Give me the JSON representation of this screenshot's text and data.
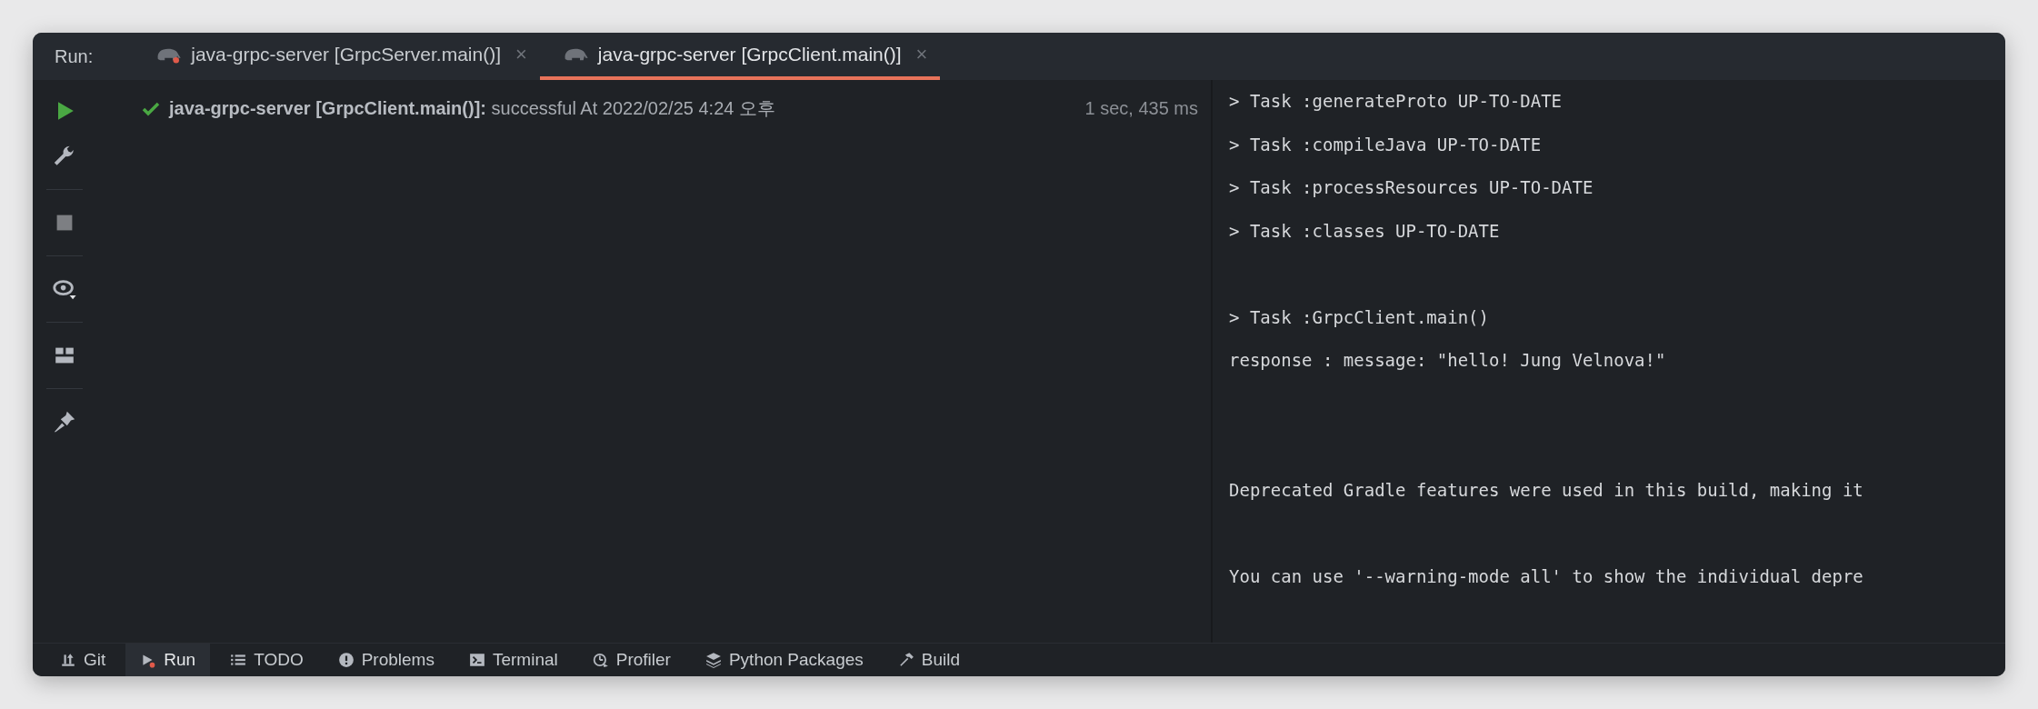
{
  "tool_window": {
    "label": "Run:"
  },
  "tabs": [
    {
      "title": "java-grpc-server [GrpcServer.main()]",
      "selected": false,
      "close": "×"
    },
    {
      "title": "java-grpc-server [GrpcClient.main()]",
      "selected": true,
      "close": "×"
    }
  ],
  "build_tree": {
    "rows": [
      {
        "kind": "success",
        "text": "**java-grpc-server [GrpcClient.main()]:** successful At 2022/02/25 4:24 오후",
        "duration": "1 sec, 435 ms"
      }
    ]
  },
  "console": {
    "lines": [
      {
        "kind": "text",
        "text": "> Task :generateProto UP-TO-DATE"
      },
      {
        "kind": "text",
        "text": "> Task :compileJava UP-TO-DATE"
      },
      {
        "kind": "text",
        "text": "> Task :processResources UP-TO-DATE"
      },
      {
        "kind": "text",
        "text": "> Task :classes UP-TO-DATE"
      },
      {
        "kind": "blank"
      },
      {
        "kind": "text",
        "text": "> Task :GrpcClient.main()"
      },
      {
        "kind": "text",
        "text": "response : message: \"hello! Jung Velnova!\""
      },
      {
        "kind": "blank"
      },
      {
        "kind": "blank"
      },
      {
        "kind": "text",
        "text": "Deprecated Gradle features were used in this build, making it"
      },
      {
        "kind": "blank"
      },
      {
        "kind": "text",
        "text": "You can use '--warning-mode all' to show the individual depre"
      }
    ]
  },
  "bottom_bar": [
    {
      "label": "Git",
      "kind": "git",
      "selected": false
    },
    {
      "label": "Run",
      "kind": "run",
      "selected": true
    },
    {
      "label": "TODO",
      "kind": "todo",
      "selected": false
    },
    {
      "label": "Problems",
      "kind": "problems",
      "selected": false
    },
    {
      "label": "Terminal",
      "kind": "terminal",
      "selected": false
    },
    {
      "label": "Profiler",
      "kind": "profiler",
      "selected": false
    },
    {
      "label": "Python Packages",
      "kind": "packages",
      "selected": false
    },
    {
      "label": "Build",
      "kind": "build",
      "selected": false
    }
  ]
}
